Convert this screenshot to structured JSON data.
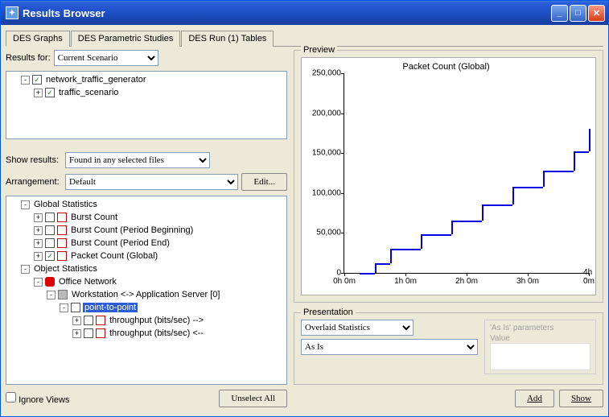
{
  "window": {
    "title": "Results Browser"
  },
  "tabs": [
    {
      "label": "DES Graphs",
      "active": true
    },
    {
      "label": "DES Parametric Studies",
      "active": false
    },
    {
      "label": "DES Run (1) Tables",
      "active": false
    }
  ],
  "results_for": {
    "label": "Results for:",
    "value": "Current Scenario"
  },
  "scenario_tree": [
    {
      "level": 0,
      "expand": "-",
      "checked": true,
      "label": "network_traffic_generator"
    },
    {
      "level": 1,
      "expand": "+",
      "checked": true,
      "label": "traffic_scenario"
    }
  ],
  "show_results": {
    "label": "Show results:",
    "value": "Found in any selected files"
  },
  "arrangement": {
    "label": "Arrangement:",
    "value": "Default",
    "edit_button": "Edit..."
  },
  "stats_tree": [
    {
      "level": 0,
      "expand": "-",
      "icon": "",
      "label": "Global Statistics"
    },
    {
      "level": 1,
      "expand": "+",
      "checked": false,
      "icon": "pdf",
      "label": "Burst Count"
    },
    {
      "level": 1,
      "expand": "+",
      "checked": false,
      "icon": "pdf",
      "label": "Burst Count (Period Beginning)"
    },
    {
      "level": 1,
      "expand": "+",
      "checked": false,
      "icon": "pdf",
      "label": "Burst Count (Period End)"
    },
    {
      "level": 1,
      "expand": "+",
      "checked": true,
      "icon": "pdf",
      "label": "Packet Count (Global)"
    },
    {
      "level": 0,
      "expand": "-",
      "icon": "",
      "label": "Object Statistics"
    },
    {
      "level": 1,
      "expand": "-",
      "icon": "red",
      "label": "Office Network"
    },
    {
      "level": 2,
      "expand": "-",
      "icon": "gray",
      "label": "Workstation <-> Application Server [0]"
    },
    {
      "level": 3,
      "expand": "-",
      "checked": false,
      "label": "point-to-point",
      "selected": true
    },
    {
      "level": 4,
      "expand": "+",
      "checked": false,
      "icon": "pdf",
      "label": "throughput (bits/sec) -->"
    },
    {
      "level": 4,
      "expand": "+",
      "checked": false,
      "icon": "pdf",
      "label": "throughput (bits/sec) <--"
    }
  ],
  "ignore_views": {
    "label": "Ignore Views",
    "checked": false
  },
  "unselect_all": "Unselect All",
  "preview": {
    "legend": "Preview",
    "chart_title": "Packet Count (Global)"
  },
  "chart_data": {
    "type": "line-step",
    "title": "Packet Count (Global)",
    "xlabel": "",
    "ylabel": "",
    "xticks": [
      "0h 0m",
      "1h 0m",
      "2h 0m",
      "3h 0m",
      "4h 0m"
    ],
    "yticks": [
      0,
      50000,
      100000,
      150000,
      200000,
      250000
    ],
    "ylim": [
      0,
      250000
    ],
    "xlim_hours": [
      0,
      4
    ],
    "series": [
      {
        "name": "Packet Count (Global)",
        "color": "#0000e0",
        "x_hours": [
          0.25,
          0.5,
          0.75,
          1.0,
          1.25,
          1.5,
          1.75,
          2.0,
          2.25,
          2.5,
          2.75,
          3.0,
          3.25,
          3.5,
          3.75,
          4.0
        ],
        "y": [
          0,
          12000,
          30000,
          30000,
          48000,
          48000,
          66000,
          66000,
          86000,
          86000,
          108000,
          108000,
          128000,
          128000,
          152000,
          180000
        ]
      }
    ]
  },
  "presentation": {
    "legend": "Presentation",
    "overlay_value": "Overlaid Statistics",
    "mode_value": "As Is",
    "asis_legend": "'As Is' parameters",
    "asis_value_label": "Value"
  },
  "buttons": {
    "add": "Add",
    "show": "Show"
  }
}
